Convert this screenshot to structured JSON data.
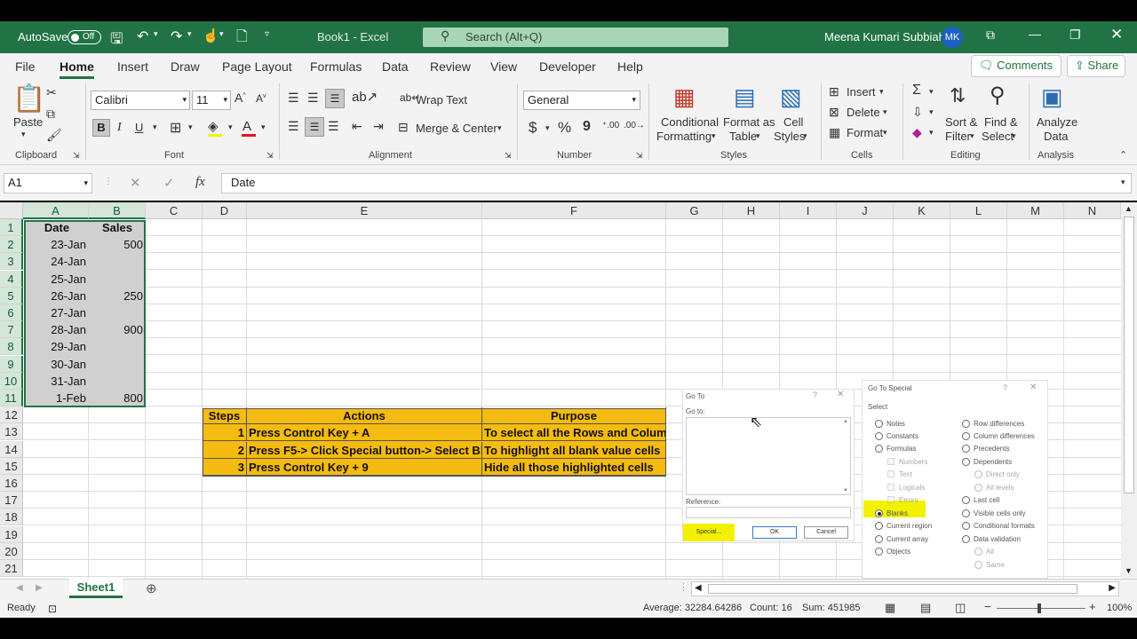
{
  "titlebar": {
    "autosave_label": "AutoSave",
    "autosave_state": "Off",
    "doc_title": "Book1  -  Excel",
    "search_placeholder": "Search (Alt+Q)",
    "user_name": "Meena Kumari Subbiah",
    "user_initials": "MK"
  },
  "menu": {
    "items": [
      "File",
      "Home",
      "Insert",
      "Draw",
      "Page Layout",
      "Formulas",
      "Data",
      "Review",
      "View",
      "Developer",
      "Help"
    ],
    "active": "Home",
    "comments": "Comments",
    "share": "Share"
  },
  "ribbon": {
    "clipboard": {
      "paste": "Paste",
      "group": "Clipboard"
    },
    "font": {
      "family": "Calibri",
      "size": "11",
      "bold": "B",
      "italic": "I",
      "underline": "U",
      "group": "Font"
    },
    "alignment": {
      "wrap": "Wrap Text",
      "merge": "Merge & Center",
      "group": "Alignment"
    },
    "number": {
      "format": "General",
      "currency": "$",
      "percent": "%",
      "comma": "9",
      "group": "Number"
    },
    "styles": {
      "conditional1": "Conditional",
      "conditional2": "Formatting",
      "format_table1": "Format as",
      "format_table2": "Table",
      "cell_styles1": "Cell",
      "cell_styles2": "Styles",
      "group": "Styles"
    },
    "cells": {
      "insert": "Insert",
      "delete": "Delete",
      "format": "Format",
      "group": "Cells"
    },
    "editing": {
      "sort1": "Sort &",
      "sort2": "Filter",
      "find1": "Find &",
      "find2": "Select",
      "group": "Editing"
    },
    "analysis": {
      "analyze1": "Analyze",
      "analyze2": "Data",
      "group": "Analysis"
    }
  },
  "formula_bar": {
    "name_box": "A1",
    "fx": "fx",
    "content": "Date"
  },
  "columns": [
    "A",
    "B",
    "C",
    "D",
    "E",
    "F",
    "G",
    "H",
    "I",
    "J",
    "K",
    "L",
    "M",
    "N"
  ],
  "rows": [
    "1",
    "2",
    "3",
    "4",
    "5",
    "6",
    "7",
    "8",
    "9",
    "10",
    "11",
    "12",
    "13",
    "14",
    "15",
    "16",
    "17",
    "18",
    "19",
    "20",
    "21"
  ],
  "data_table": {
    "headers": [
      "Date",
      "Sales"
    ],
    "rows": [
      [
        "23-Jan",
        "500"
      ],
      [
        "24-Jan",
        ""
      ],
      [
        "25-Jan",
        ""
      ],
      [
        "26-Jan",
        "250"
      ],
      [
        "27-Jan",
        ""
      ],
      [
        "28-Jan",
        "900"
      ],
      [
        "29-Jan",
        ""
      ],
      [
        "30-Jan",
        ""
      ],
      [
        "31-Jan",
        ""
      ],
      [
        "1-Feb",
        "800"
      ]
    ]
  },
  "steps_table": {
    "headers": [
      "Steps",
      "Actions",
      "Purpose"
    ],
    "rows": [
      [
        "1",
        "Press Control Key + A",
        "To select all the Rows and Columns"
      ],
      [
        "2",
        "Press F5-> Click Special button-> Select Blanks",
        "To highlight all blank value cells"
      ],
      [
        "3",
        "Press Control Key + 9",
        "Hide all those highlighted cells"
      ]
    ]
  },
  "goto_dialog": {
    "title": "Go To",
    "goto_label": "Go to:",
    "reference_label": "Reference:",
    "special": "Special...",
    "ok": "OK",
    "cancel": "Cancel"
  },
  "goto_special": {
    "title": "Go To Special",
    "select_label": "Select",
    "left": [
      "Notes",
      "Constants",
      "Formulas",
      "Numbers",
      "Text",
      "Logicals",
      "Errors",
      "Blanks",
      "Current region",
      "Current array",
      "Objects"
    ],
    "right": [
      "Row differences",
      "Column differences",
      "Precedents",
      "Dependents",
      "Direct only",
      "All levels",
      "Last cell",
      "Visible cells only",
      "Conditional formats",
      "Data validation",
      "All",
      "Same"
    ],
    "selected": "Blanks"
  },
  "sheet_tabs": {
    "active": "Sheet1"
  },
  "status": {
    "ready": "Ready",
    "average": "Average: 32284.64286",
    "count": "Count: 16",
    "sum": "Sum: 451985",
    "zoom": "100%"
  },
  "colors": {
    "excel_green": "#217346",
    "table_fill": "#f5bb10",
    "highlight": "#f2f200"
  }
}
